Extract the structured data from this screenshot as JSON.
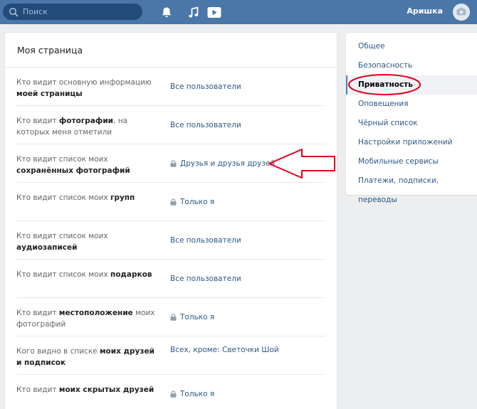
{
  "header": {
    "search_placeholder": "Поиск",
    "username": "Аришка",
    "icons": [
      "search-icon",
      "bell-icon",
      "music-icon",
      "video-icon",
      "camera-icon"
    ],
    "bar_color": "#4a76a8"
  },
  "main": {
    "title": "Моя страница",
    "rows": [
      {
        "label_pre": "Кто видит основную информацию ",
        "label_bold": "моей страницы",
        "label_post": "",
        "value": "Все пользователи",
        "locked": false
      },
      {
        "label_pre": "Кто видит ",
        "label_bold": "фотографии",
        "label_post": ", на которых меня отметили",
        "value": "Все пользователи",
        "locked": false
      },
      {
        "label_pre": "Кто видит список моих ",
        "label_bold": "сохранённых фотографий",
        "label_post": "",
        "value": "Друзья и друзья друзей",
        "locked": true
      },
      {
        "label_pre": "Кто видит список моих ",
        "label_bold": "групп",
        "label_post": "",
        "value": "Только я",
        "locked": true
      },
      {
        "label_pre": "Кто видит список моих ",
        "label_bold": "аудиозаписей",
        "label_post": "",
        "value": "Все пользователи",
        "locked": false
      },
      {
        "label_pre": "Кто видит список моих ",
        "label_bold": "подарков",
        "label_post": "",
        "value": "Все пользователи",
        "locked": false
      },
      {
        "label_pre": "Кто видит ",
        "label_bold": "местоположение",
        "label_post": " моих фотографий",
        "value": "Только я",
        "locked": true
      },
      {
        "label_pre": "Кого видно в списке ",
        "label_bold": "моих друзей и подписок",
        "label_post": "",
        "value": "Всех, кроме: Светочки Шой",
        "locked": false
      },
      {
        "label_pre": "Кто видит ",
        "label_bold": "моих скрытых друзей",
        "label_post": "",
        "value": "Только я",
        "locked": true
      }
    ]
  },
  "nav": {
    "items": [
      {
        "label": "Общее",
        "active": false
      },
      {
        "label": "Безопасность",
        "active": false
      },
      {
        "label": "Приватность",
        "active": true
      },
      {
        "label": "Оповещения",
        "active": false
      },
      {
        "label": "Чёрный список",
        "active": false
      },
      {
        "label": "Настройки приложений",
        "active": false
      },
      {
        "label": "Мобильные сервисы",
        "active": false
      },
      {
        "label": "Платежи, подписки, переводы",
        "active": false
      }
    ]
  },
  "annotations": {
    "color": "#e5001c",
    "arrow_target": "Друзья и друзья друзей",
    "circle_target": "Приватность"
  }
}
